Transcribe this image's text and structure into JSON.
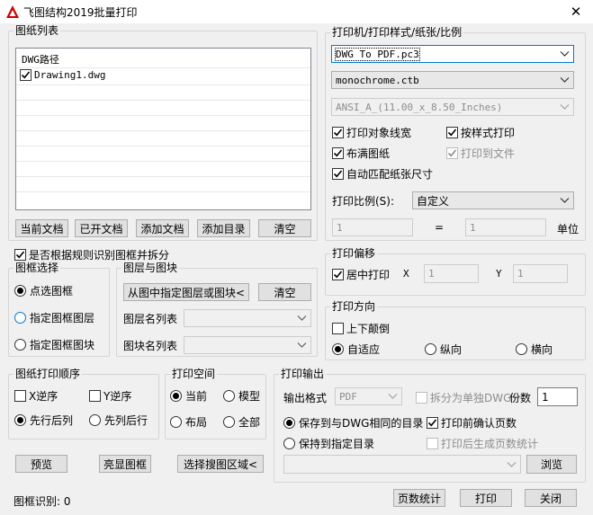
{
  "window": {
    "title": "飞图结构2019批量打印",
    "close": "✕"
  },
  "drawing_list": {
    "group_label": "图纸列表",
    "header": "DWG路径",
    "items": [
      {
        "name": "Drawing1.dwg",
        "checked": true
      }
    ],
    "buttons": {
      "current_doc": "当前文档",
      "opened_doc": "已开文档",
      "add_doc": "添加文档",
      "add_dir": "添加目录",
      "clear": "清空"
    }
  },
  "auto_split": {
    "label": "是否根据规则识别图框并拆分",
    "checked": true
  },
  "frame_select": {
    "group_label": "图框选择",
    "options": [
      "点选图框",
      "指定图框图层",
      "指定图框图块"
    ],
    "selected": 0
  },
  "layer_block": {
    "group_label": "图层与图块",
    "pick_button": "从图中指定图层或图块<",
    "clear_button": "清空",
    "layer_label": "图层名列表",
    "block_label": "图块名列表",
    "layer_value": "",
    "block_value": ""
  },
  "printer": {
    "group_label": "打印机/打印样式/纸张/比例",
    "device": "DWG To PDF.pc3",
    "style": "monochrome.ctb",
    "paper": "ANSI_A_(11.00_x_8.50_Inches)",
    "options": {
      "print_lineweight": {
        "label": "打印对象线宽",
        "checked": true
      },
      "by_style": {
        "label": "按样式打印",
        "checked": true
      },
      "fit_paper": {
        "label": "布满图纸",
        "checked": true
      },
      "print_to_file": {
        "label": "打印到文件",
        "checked": true
      },
      "auto_paper": {
        "label": "自动匹配纸张尺寸",
        "checked": true
      }
    },
    "scale_label": "打印比例(S):",
    "scale_value": "自定义",
    "scale_num": "1",
    "equals": "=",
    "scale_den": "1",
    "unit_label": "单位"
  },
  "offset": {
    "group_label": "打印偏移",
    "center": {
      "label": "居中打印",
      "checked": true
    },
    "x_label": "X",
    "x_value": "1",
    "y_label": "Y",
    "y_value": "1"
  },
  "orientation": {
    "group_label": "打印方向",
    "upside_down": {
      "label": "上下颠倒",
      "checked": false
    },
    "options": [
      "自适应",
      "纵向",
      "横向"
    ],
    "selected": 0
  },
  "print_order": {
    "group_label": "图纸打印顺序",
    "x_reverse": {
      "label": "X逆序",
      "checked": false
    },
    "y_reverse": {
      "label": "Y逆序",
      "checked": false
    },
    "options": [
      "先行后列",
      "先列后行"
    ],
    "selected": 0
  },
  "print_space": {
    "group_label": "打印空间",
    "options": [
      "当前",
      "模型",
      "布局",
      "全部"
    ],
    "selected": 0
  },
  "output": {
    "group_label": "打印输出",
    "format_label": "输出格式",
    "format_value": "PDF",
    "split_dwg": {
      "label": "拆分为单独DWG",
      "checked": false
    },
    "copies_label": "份数",
    "copies_value": "1",
    "save_same": "保存到与DWG相同的目录",
    "save_specified": "保持到指定目录",
    "save_selected": 0,
    "confirm_pages": {
      "label": "打印前确认页数",
      "checked": true
    },
    "page_stats": {
      "label": "打印后生成页数统计",
      "checked": false
    },
    "dir_value": "",
    "browse": "浏览"
  },
  "bottom": {
    "preview": "预览",
    "highlight": "亮显图框",
    "select_area": "选择搜图区域<",
    "status": "图框识别: 0",
    "page_count": "页数统计",
    "print": "打印",
    "close": "关闭"
  },
  "colors": {
    "focus": "#0078d7",
    "button_bg": "#e1e1e1",
    "dialog_bg": "#f0f0f0"
  }
}
